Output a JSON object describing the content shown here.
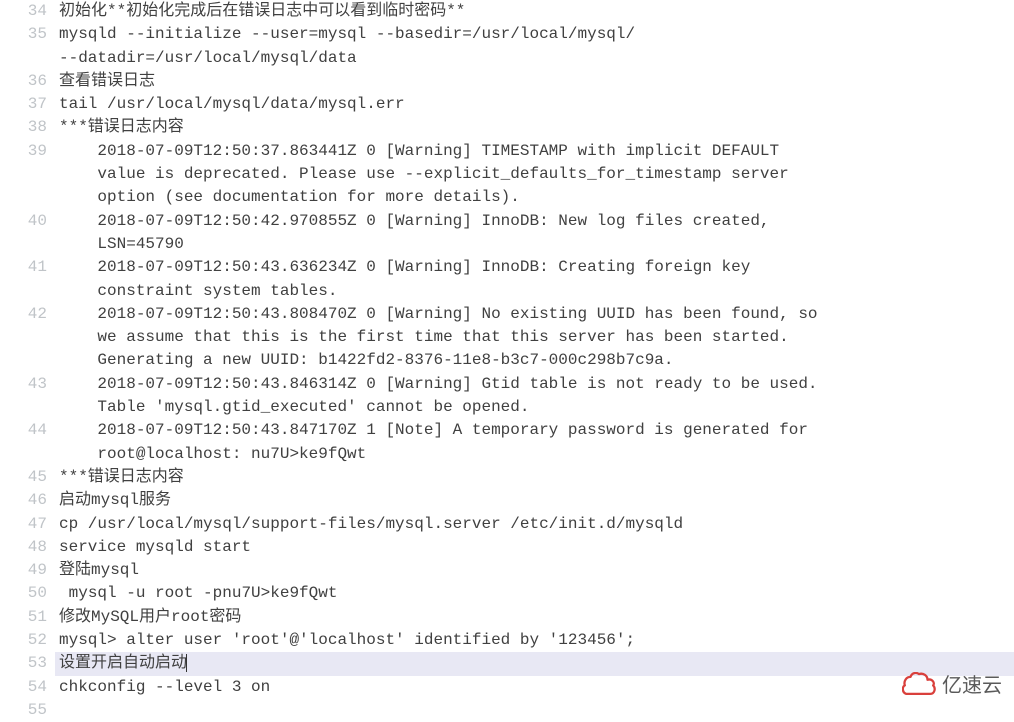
{
  "lines": [
    {
      "num": "34",
      "text": "初始化**初始化完成后在错误日志中可以看到临时密码**",
      "highlight": false,
      "wraps": 0
    },
    {
      "num": "35",
      "text": "mysqld --initialize --user=mysql --basedir=/usr/local/mysql/ --datadir=/usr/local/mysql/data",
      "highlight": false,
      "wraps": 1
    },
    {
      "num": "36",
      "text": "查看错误日志",
      "highlight": false,
      "wraps": 0
    },
    {
      "num": "37",
      "text": "tail /usr/local/mysql/data/mysql.err",
      "highlight": false,
      "wraps": 0
    },
    {
      "num": "38",
      "text": "***错误日志内容",
      "highlight": false,
      "wraps": 0
    },
    {
      "num": "39",
      "text": "    2018-07-09T12:50:37.863441Z 0 [Warning] TIMESTAMP with implicit DEFAULT value is deprecated. Please use --explicit_defaults_for_timestamp server option (see documentation for more details).",
      "highlight": false,
      "wraps": 2
    },
    {
      "num": "40",
      "text": "    2018-07-09T12:50:42.970855Z 0 [Warning] InnoDB: New log files created, LSN=45790",
      "highlight": false,
      "wraps": 1
    },
    {
      "num": "41",
      "text": "    2018-07-09T12:50:43.636234Z 0 [Warning] InnoDB: Creating foreign key constraint system tables.",
      "highlight": false,
      "wraps": 1
    },
    {
      "num": "42",
      "text": "    2018-07-09T12:50:43.808470Z 0 [Warning] No existing UUID has been found, so we assume that this is the first time that this server has been started. Generating a new UUID: b1422fd2-8376-11e8-b3c7-000c298b7c9a.",
      "highlight": false,
      "wraps": 2
    },
    {
      "num": "43",
      "text": "    2018-07-09T12:50:43.846314Z 0 [Warning] Gtid table is not ready to be used. Table 'mysql.gtid_executed' cannot be opened.",
      "highlight": false,
      "wraps": 1
    },
    {
      "num": "44",
      "text": "    2018-07-09T12:50:43.847170Z 1 [Note] A temporary password is generated for root@localhost: nu7U>ke9fQwt",
      "highlight": false,
      "wraps": 1
    },
    {
      "num": "45",
      "text": "***错误日志内容",
      "highlight": false,
      "wraps": 0
    },
    {
      "num": "46",
      "text": "启动mysql服务",
      "highlight": false,
      "wraps": 0
    },
    {
      "num": "47",
      "text": "cp /usr/local/mysql/support-files/mysql.server /etc/init.d/mysqld",
      "highlight": false,
      "wraps": 0
    },
    {
      "num": "48",
      "text": "service mysqld start",
      "highlight": false,
      "wraps": 0
    },
    {
      "num": "49",
      "text": "登陆mysql",
      "highlight": false,
      "wraps": 0
    },
    {
      "num": "50",
      "text": " mysql -u root -pnu7U>ke9fQwt",
      "highlight": false,
      "wraps": 0
    },
    {
      "num": "51",
      "text": "修改MySQL用户root密码",
      "highlight": false,
      "wraps": 0
    },
    {
      "num": "52",
      "text": "mysql> alter user 'root'@'localhost' identified by '123456';",
      "highlight": false,
      "wraps": 0
    },
    {
      "num": "53",
      "text": "设置开启自动启动",
      "highlight": true,
      "wraps": 0,
      "cursor": true
    },
    {
      "num": "54",
      "text": "chkconfig --level 3 on",
      "highlight": false,
      "wraps": 0
    },
    {
      "num": "55",
      "text": "",
      "highlight": false,
      "wraps": 0
    }
  ],
  "watermark": {
    "text": "亿速云"
  }
}
